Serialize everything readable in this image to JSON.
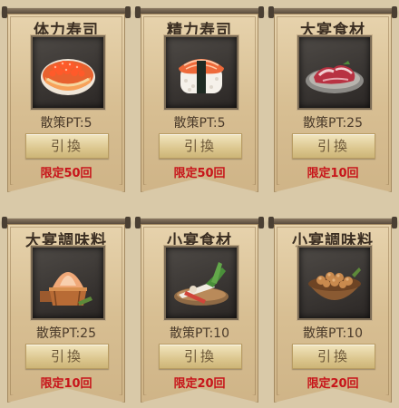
{
  "items": [
    {
      "title": "体力寿司",
      "cost": "散策PT:5",
      "button": "引換",
      "limit": "限定50回",
      "icon": "salmon-roe-sushi-icon"
    },
    {
      "title": "精力寿司",
      "cost": "散策PT:5",
      "button": "引換",
      "limit": "限定50回",
      "icon": "salmon-nigiri-sushi-icon"
    },
    {
      "title": "大宴食材",
      "cost": "散策PT:25",
      "button": "引換",
      "limit": "限定10回",
      "icon": "meat-plate-icon"
    },
    {
      "title": "大宴調味料",
      "cost": "散策PT:25",
      "button": "引換",
      "limit": "限定10回",
      "icon": "salt-tub-icon"
    },
    {
      "title": "小宴食材",
      "cost": "散策PT:10",
      "button": "引換",
      "limit": "限定20回",
      "icon": "radish-vegetables-icon"
    },
    {
      "title": "小宴調味料",
      "cost": "散策PT:10",
      "button": "引換",
      "limit": "限定20回",
      "icon": "spice-bowl-icon"
    }
  ],
  "colors": {
    "limit_text": "#c7141a",
    "banner": "#d8bf93",
    "background": "#d9c9a8"
  }
}
